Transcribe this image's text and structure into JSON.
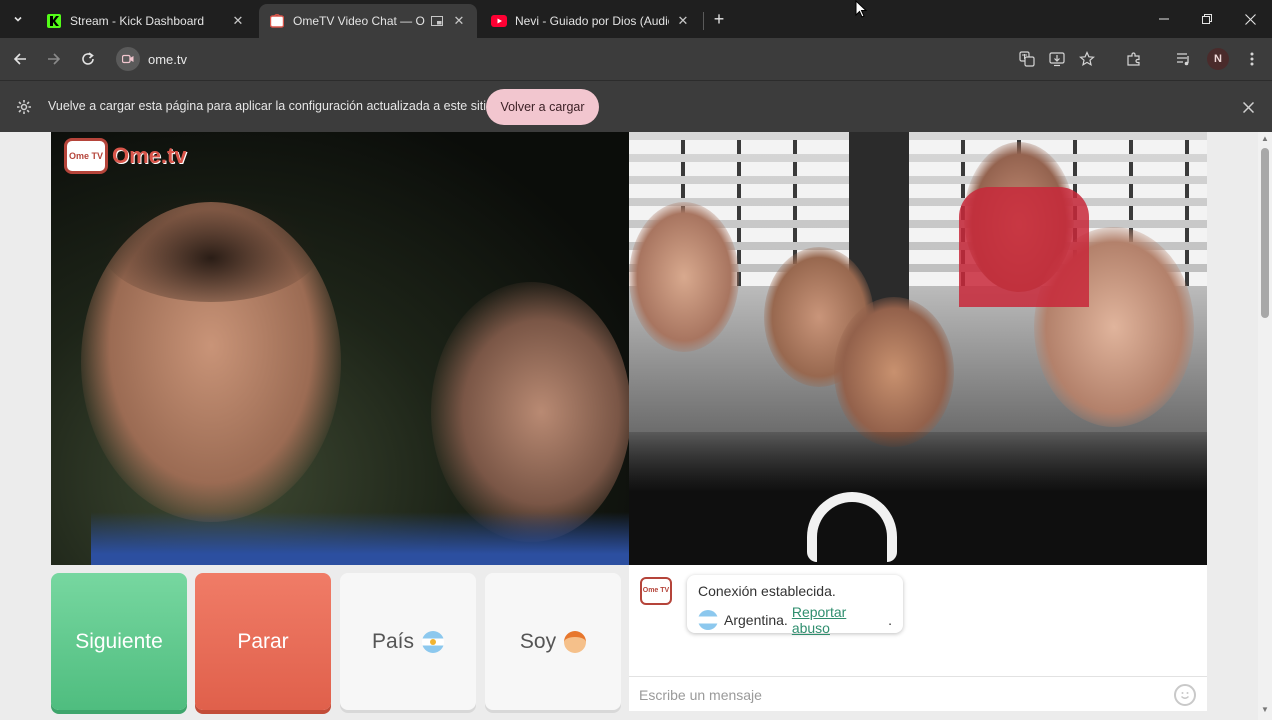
{
  "browser": {
    "tabs": [
      {
        "title": "Stream - Kick Dashboard",
        "favicon": "kick-icon",
        "active": false
      },
      {
        "title": "OmeTV Video Chat — Ome",
        "favicon": "ometv-icon",
        "active": true
      },
      {
        "title": "Nevi - Guiado por Dios (Audio",
        "favicon": "youtube-icon",
        "active": false
      }
    ],
    "new_tab": "+",
    "url": "ome.tv",
    "profile_initial": "N",
    "colors": {
      "frame": "#1f1f1f",
      "toolbar": "#3c3c3c",
      "reload_button": "#f2c6cf"
    }
  },
  "infobar": {
    "message": "Vuelve a cargar esta página para aplicar la configuración actualizada a este sitio",
    "button_label": "Volver a cargar"
  },
  "ometv": {
    "logo_box": "Ome TV",
    "logo_text": "Ome.tv",
    "buttons": {
      "next": "Siguiente",
      "stop": "Parar",
      "country": "País",
      "gender": "Soy"
    },
    "colors": {
      "next": "#5cc98c",
      "stop": "#e86a55",
      "link": "#2f8e6e"
    },
    "chat": {
      "logo_box": "Ome TV",
      "status": "Conexión establecida.",
      "country": "Argentina.",
      "report_link": "Reportar abuso",
      "report_suffix": ".",
      "input_placeholder": "Escribe un mensaje"
    }
  }
}
